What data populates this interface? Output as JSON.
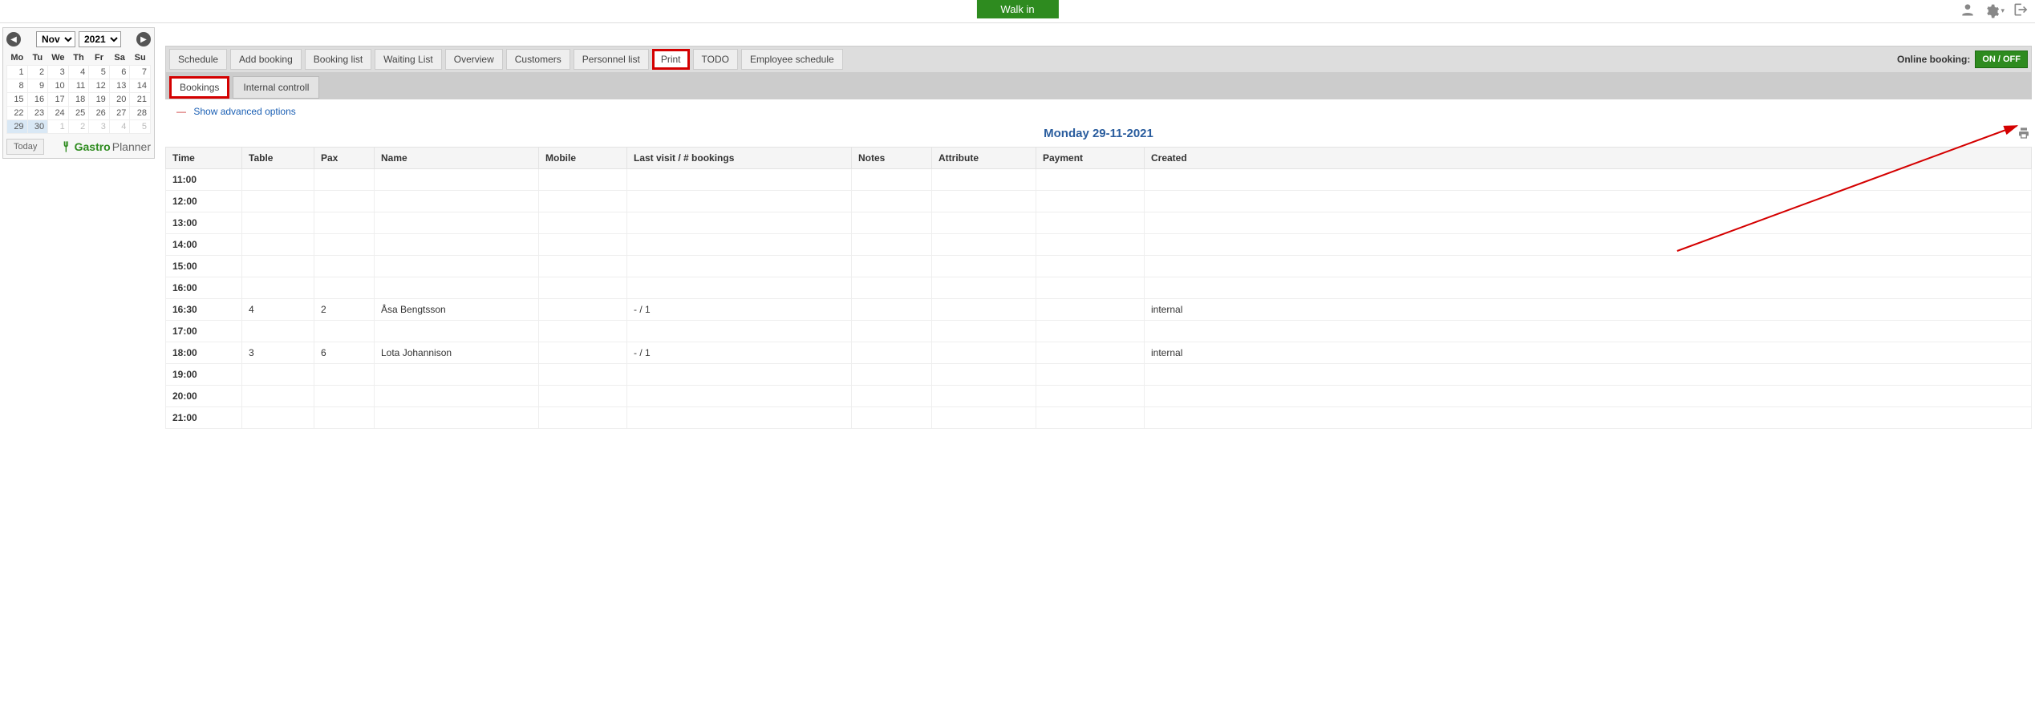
{
  "topbar": {
    "walk_in": "Walk in"
  },
  "calendar": {
    "month": "Nov",
    "year": "2021",
    "today_btn": "Today",
    "logo_brand": "Gastro",
    "logo_thin": "Planner",
    "dow": [
      "Mo",
      "Tu",
      "We",
      "Th",
      "Fr",
      "Sa",
      "Su"
    ],
    "rows": [
      [
        {
          "d": "1"
        },
        {
          "d": "2"
        },
        {
          "d": "3"
        },
        {
          "d": "4"
        },
        {
          "d": "5"
        },
        {
          "d": "6"
        },
        {
          "d": "7"
        }
      ],
      [
        {
          "d": "8"
        },
        {
          "d": "9"
        },
        {
          "d": "10"
        },
        {
          "d": "11"
        },
        {
          "d": "12"
        },
        {
          "d": "13"
        },
        {
          "d": "14"
        }
      ],
      [
        {
          "d": "15"
        },
        {
          "d": "16"
        },
        {
          "d": "17"
        },
        {
          "d": "18"
        },
        {
          "d": "19"
        },
        {
          "d": "20"
        },
        {
          "d": "21"
        }
      ],
      [
        {
          "d": "22"
        },
        {
          "d": "23"
        },
        {
          "d": "24"
        },
        {
          "d": "25"
        },
        {
          "d": "26"
        },
        {
          "d": "27"
        },
        {
          "d": "28"
        }
      ],
      [
        {
          "d": "29",
          "sel": true
        },
        {
          "d": "30",
          "sel": true
        },
        {
          "d": "1",
          "other": true
        },
        {
          "d": "2",
          "other": true
        },
        {
          "d": "3",
          "other": true
        },
        {
          "d": "4",
          "other": true
        },
        {
          "d": "5",
          "other": true
        }
      ]
    ]
  },
  "main_tabs": {
    "items": [
      "Schedule",
      "Add booking",
      "Booking list",
      "Waiting List",
      "Overview",
      "Customers",
      "Personnel list",
      "Print",
      "TODO",
      "Employee schedule"
    ],
    "highlight_index": 7,
    "online_label": "Online booking:",
    "online_toggle": "ON / OFF"
  },
  "sub_tabs": {
    "items": [
      "Bookings",
      "Internal controll"
    ],
    "highlight_index": 0
  },
  "adv_options_label": "Show advanced options",
  "date_title": "Monday 29-11-2021",
  "booking_table": {
    "headers": [
      "Time",
      "Table",
      "Pax",
      "Name",
      "Mobile",
      "Last visit / # bookings",
      "Notes",
      "Attribute",
      "Payment",
      "Created"
    ],
    "col_widths": [
      "95px",
      "90px",
      "75px",
      "205px",
      "110px",
      "280px",
      "100px",
      "130px",
      "135px",
      ""
    ],
    "rows": [
      {
        "time": "11:00"
      },
      {
        "time": "12:00"
      },
      {
        "time": "13:00"
      },
      {
        "time": "14:00"
      },
      {
        "time": "15:00"
      },
      {
        "time": "16:00"
      },
      {
        "time": "16:30",
        "table": "4",
        "pax": "2",
        "name": "Åsa Bengtsson",
        "last": "- / 1",
        "created": "internal"
      },
      {
        "time": "17:00"
      },
      {
        "time": "18:00",
        "table": "3",
        "pax": "6",
        "name": "Lota Johannison",
        "last": "- / 1",
        "created": "internal"
      },
      {
        "time": "19:00"
      },
      {
        "time": "20:00"
      },
      {
        "time": "21:00"
      }
    ]
  }
}
